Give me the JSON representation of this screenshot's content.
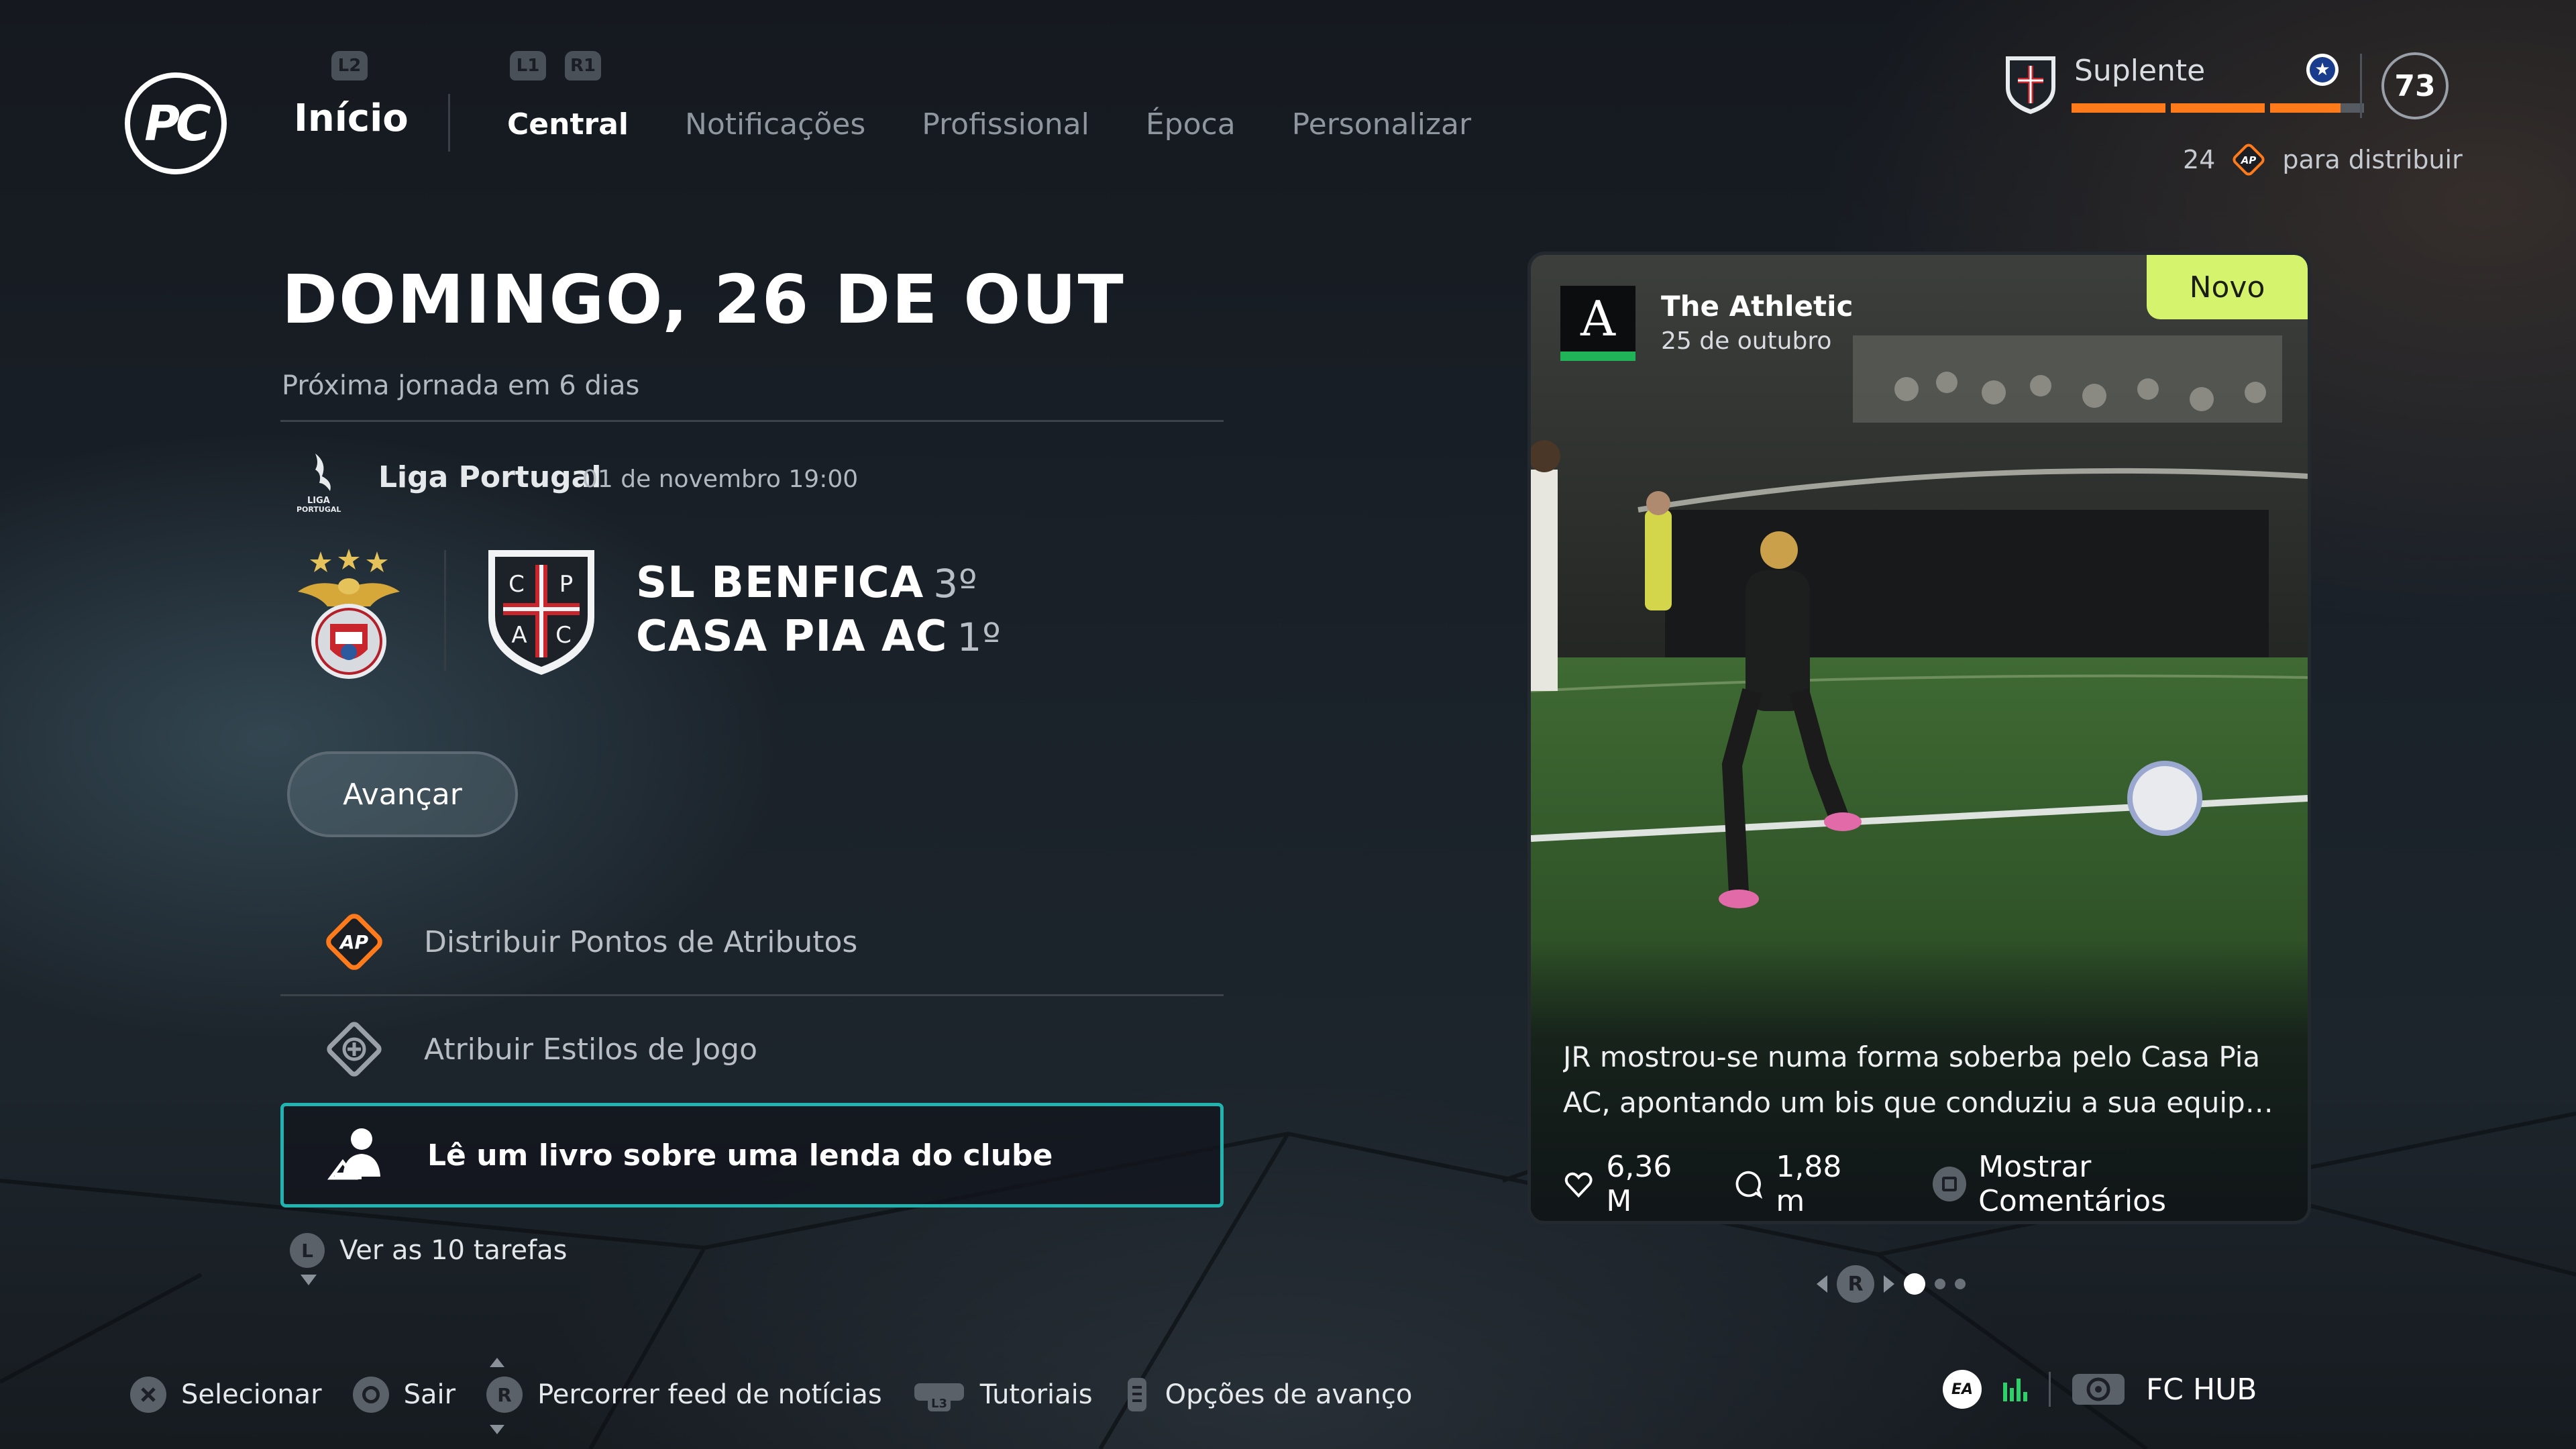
{
  "header": {
    "logo_text": "PC",
    "home_hint": "L2",
    "home_label": "Início",
    "tab_hints": [
      "L1",
      "R1"
    ],
    "tabs": [
      {
        "label": "Central",
        "active": true
      },
      {
        "label": "Notificações",
        "active": false
      },
      {
        "label": "Profissional",
        "active": false
      },
      {
        "label": "Época",
        "active": false
      },
      {
        "label": "Personalizar",
        "active": false
      }
    ]
  },
  "profile": {
    "rank_label": "Suplente",
    "progress_segments_filled": 2.75,
    "progress_segments_total": 3,
    "overall": "73",
    "ap_count": "24",
    "ap_badge": "AP",
    "ap_suffix": "para distribuir",
    "star_icon": "★"
  },
  "fixture": {
    "date_title": "DOMINGO, 26 DE OUT",
    "next_round": "Próxima jornada em 6 dias",
    "league": "Liga Portugal",
    "league_logo_text": [
      "LIGA",
      "PORTUGAL"
    ],
    "kickoff": "01 de novembro 19:00",
    "home_team": "SL BENFICA",
    "home_pos": "3º",
    "away_team": "CASA PIA AC",
    "away_pos": "1º",
    "away_crest_letters": [
      "C",
      "P",
      "A",
      "C"
    ],
    "advance_label": "Avançar"
  },
  "tasks": [
    {
      "label": "Distribuir Pontos de Atributos",
      "icon": "ap-diamond-icon",
      "selected": false
    },
    {
      "label": "Atribuir Estilos de Jogo",
      "icon": "playstyle-diamond-icon",
      "selected": false
    },
    {
      "label": "Lê um livro sobre uma lenda do clube",
      "icon": "person-book-icon",
      "selected": true
    }
  ],
  "see_all": {
    "hint": "L",
    "label": "Ver as 10 tarefas"
  },
  "news": {
    "badge": "Novo",
    "publisher_logo": "A",
    "publisher": "The Athletic",
    "date": "25 de outubro",
    "text_line1": "JR mostrou-se numa forma soberba pelo Casa Pia",
    "text_line2": "AC, apontando um bis que conduziu a sua equipa a ...",
    "likes": "6,36 M",
    "comments": "1,88 m",
    "comments_label": "Mostrar Comentários",
    "pager_hint": "R",
    "pager_index": 1,
    "pager_total": 3
  },
  "footer": {
    "hints": [
      {
        "button": "cross",
        "label": "Selecionar"
      },
      {
        "button": "circle",
        "label": "Sair"
      },
      {
        "button": "R",
        "label": "Percorrer feed de notícias"
      },
      {
        "button": "L3",
        "label": "Tutoriais"
      },
      {
        "button": "options",
        "label": "Opções de avanço"
      }
    ],
    "ea_logo": "EA",
    "hub_label": "FC HUB"
  },
  "colors": {
    "accent_teal": "#1fb4b0",
    "progress_orange": "#ff7a1a",
    "novo_green": "#d5f36d"
  }
}
